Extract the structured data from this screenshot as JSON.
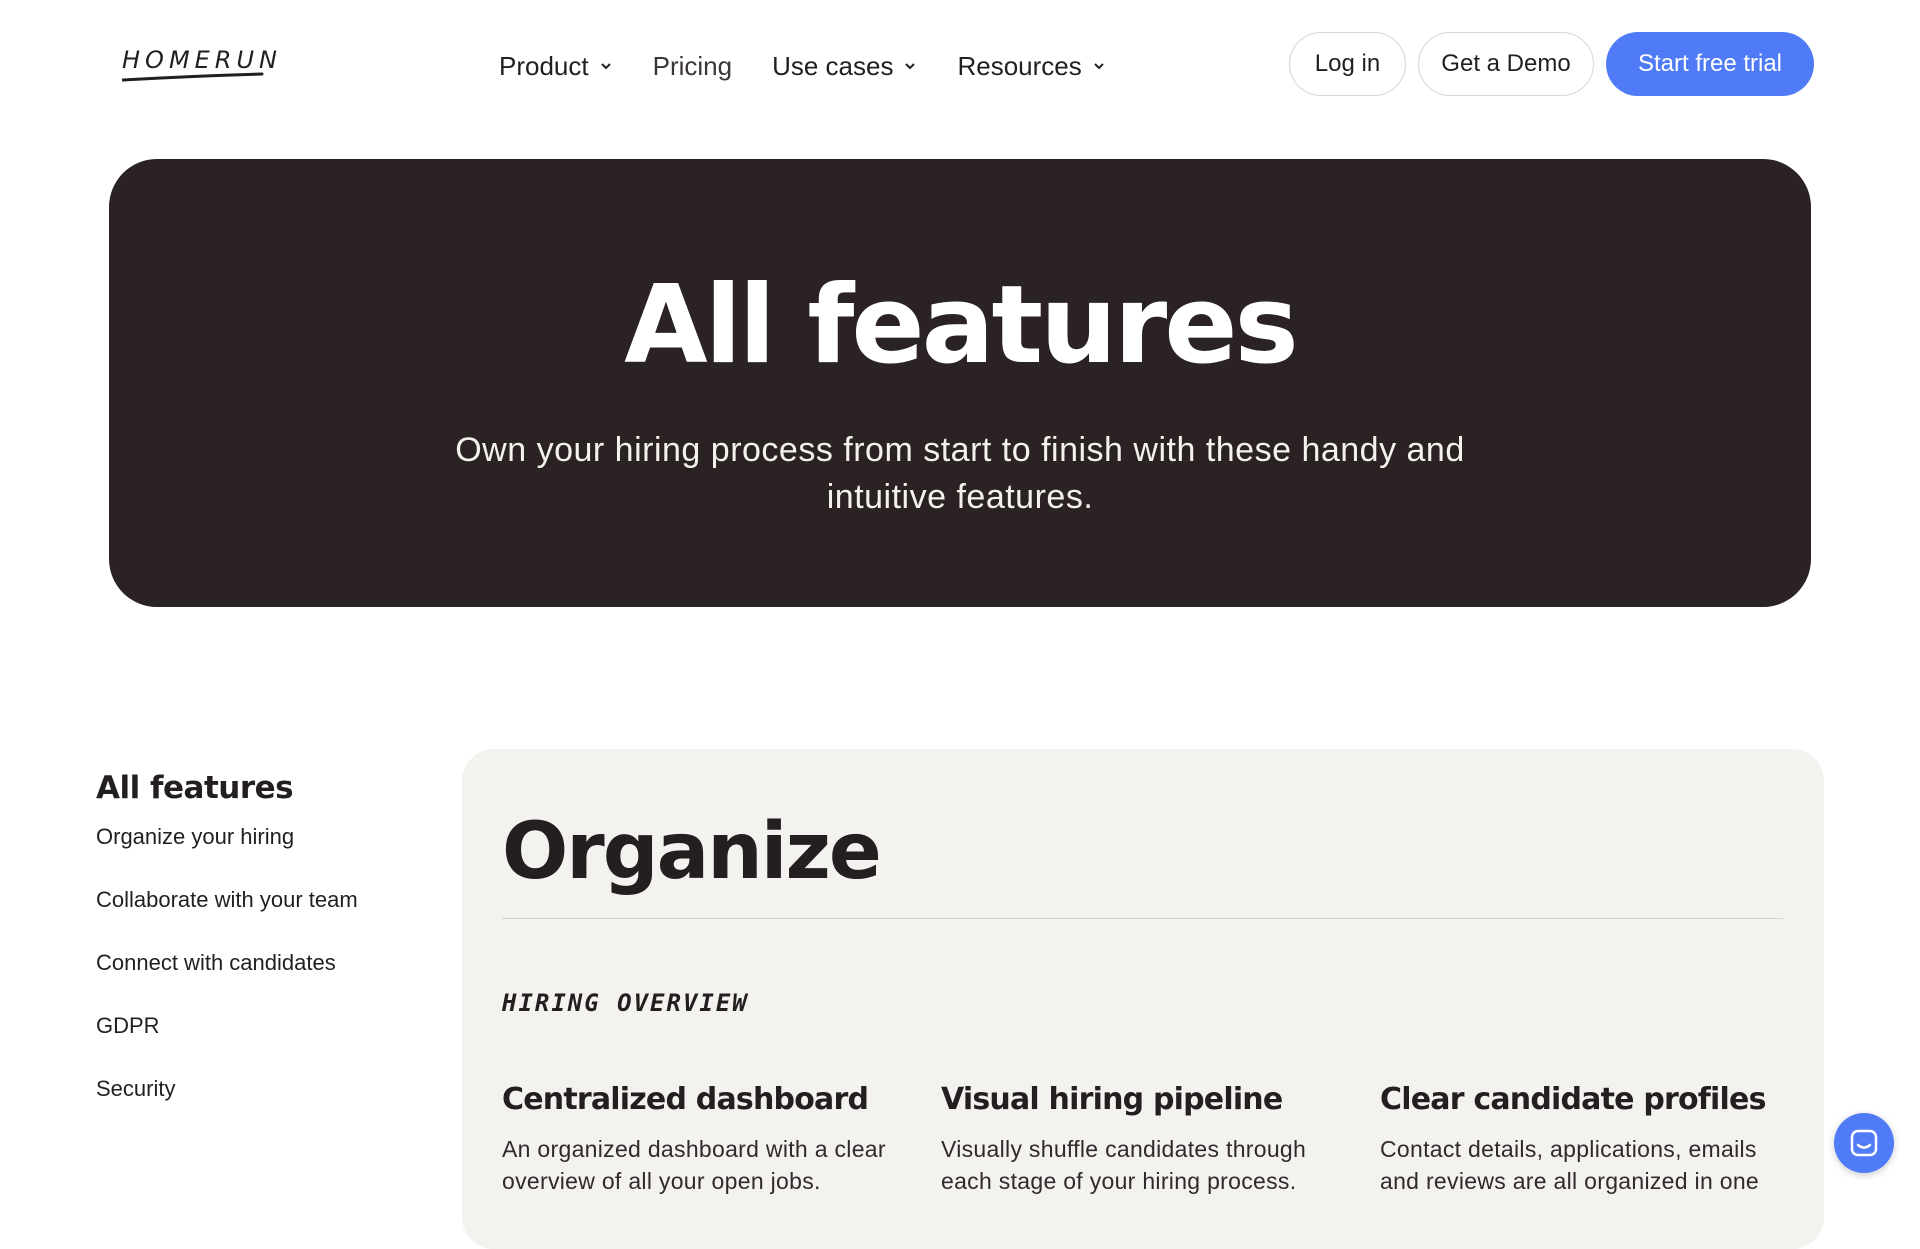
{
  "header": {
    "logo": "HOMERUN",
    "nav": [
      {
        "label": "Product",
        "dropdown": true
      },
      {
        "label": "Pricing",
        "dropdown": false
      },
      {
        "label": "Use cases",
        "dropdown": true
      },
      {
        "label": "Resources",
        "dropdown": true
      }
    ],
    "login_label": "Log in",
    "demo_label": "Get a Demo",
    "trial_label": "Start free trial"
  },
  "hero": {
    "title": "All features",
    "subtitle": "Own your hiring process from start to finish with these handy and intuitive features."
  },
  "sidebar": {
    "title": "All features",
    "links": [
      "Organize your hiring",
      "Collaborate with your team",
      "Connect with candidates",
      "GDPR",
      "Security"
    ]
  },
  "main": {
    "title": "Organize",
    "eyebrow": "Hiring overview",
    "features": [
      {
        "title": "Centralized dashboard",
        "description": "An organized dashboard with a clear overview of all your open jobs."
      },
      {
        "title": "Visual hiring pipeline",
        "description": "Visually shuffle candidates through each stage of your hiring process."
      },
      {
        "title": "Clear candidate profiles",
        "description": "Contact details, applications, emails and reviews are all organized in one"
      }
    ]
  },
  "colors": {
    "accent": "#4f7cf6",
    "hero_bg": "#2a2223",
    "panel_bg": "#f3f2ef",
    "text": "#231f20"
  },
  "icons": {
    "nav_dropdown": "chevron-down-icon",
    "chat": "chat-icon"
  }
}
